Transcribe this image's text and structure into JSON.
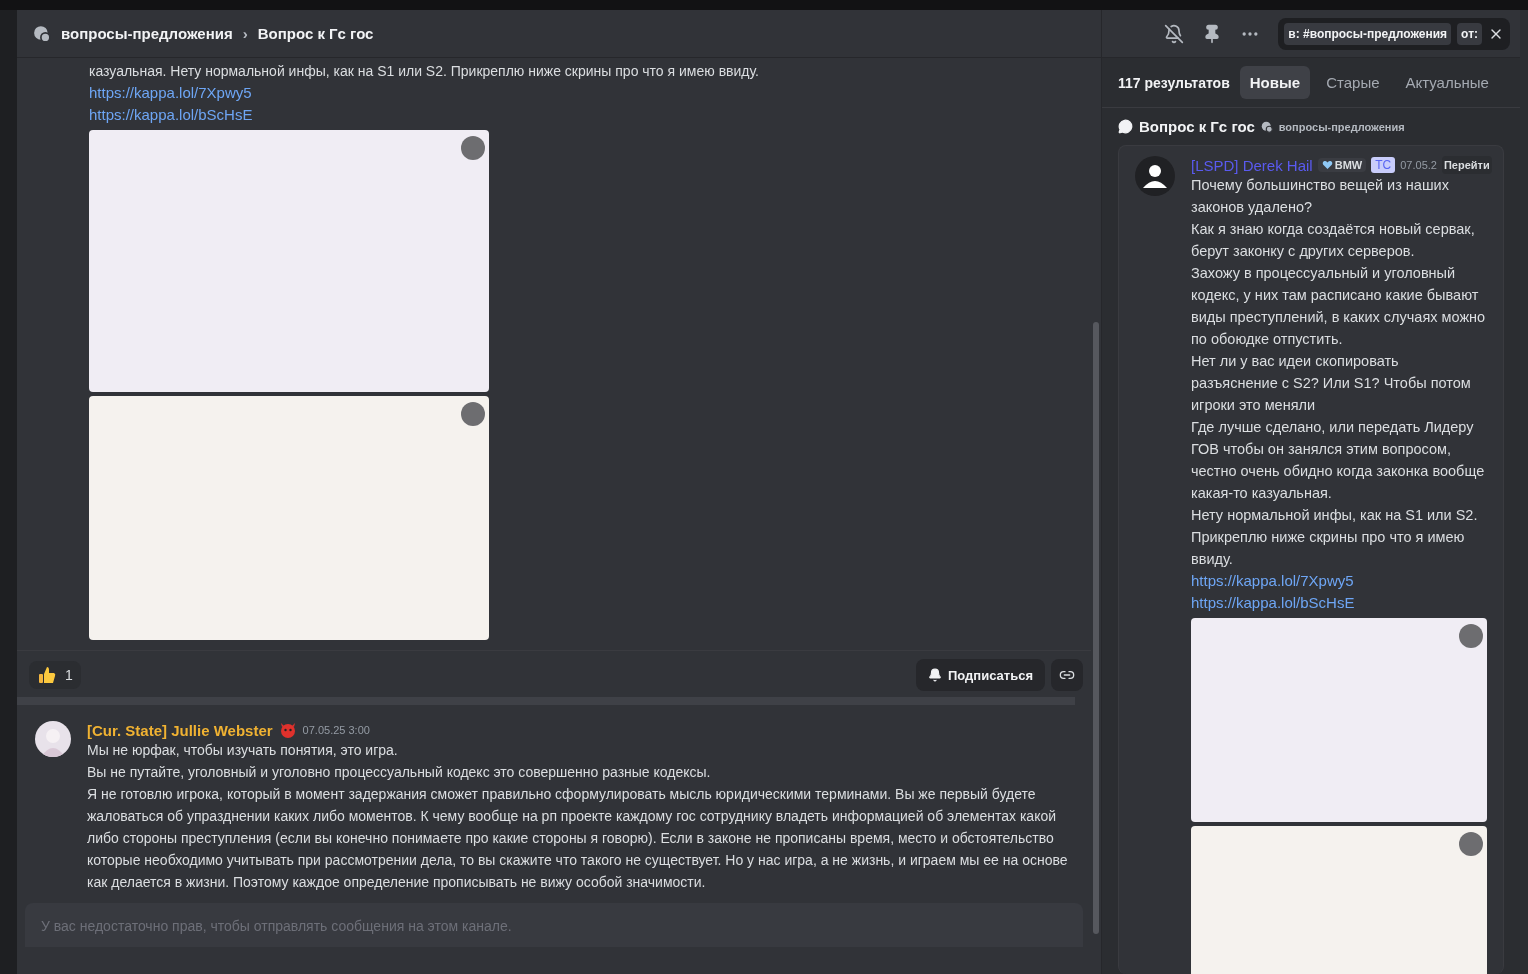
{
  "header": {
    "channel": "вопросы-предложения",
    "separator": "›",
    "thread": "Вопрос к Гс гос"
  },
  "search": {
    "chips": [
      "в: #вопросы-предложения",
      "от:"
    ]
  },
  "main_message": {
    "text_tail": "казуальная. Нету нормальной инфы, как на S1 или S2. Прикреплю ниже скрины про что я имею ввиду.",
    "links": [
      "https://kappa.lol/7Xpwy5",
      "https://kappa.lol/bScHsE"
    ],
    "attachments": [
      {
        "kind": "image"
      },
      {
        "kind": "image"
      }
    ]
  },
  "reactions": [
    {
      "count": "1"
    }
  ],
  "thread_actions": {
    "follow": "Подписаться"
  },
  "reply": {
    "author": "[Cur. State] Jullie Webster",
    "time": "07.05.25 3:00",
    "paragraphs": [
      "Мы не юрфак, чтобы изучать понятия, это игра.",
      "Вы не путайте, уголовный и уголовно процессуальный кодекс это совершенно разные кодексы.",
      "Я не готовлю игрока, который в момент задержания сможет правильно сформулировать мысль юридическими терминами. Вы же первый будете жаловаться об упразднении каких либо моментов. К чему вообще на рп проекте каждому гос сотруднику владеть информацией об элементах какой либо стороны преступления (если вы конечно понимаете про какие стороны я говорю). Если в законе не прописаны время, место и обстоятельство которые необходимо учитывать при рассмотрении дела, то вы скажите что такого не существует. Но у нас игра, а не жизнь, и играем мы ее на основе как делается в жизни. Поэтому каждое определение прописывать не вижу особой значимости."
    ]
  },
  "composer": {
    "placeholder": "У вас недостаточно прав, чтобы отправлять сообщения на этом канале."
  },
  "results": {
    "count": "117 результатов",
    "tabs": [
      {
        "label": "Новые",
        "selected": true
      },
      {
        "label": "Старые",
        "selected": false
      },
      {
        "label": "Актуальные",
        "selected": false
      }
    ],
    "thread": {
      "title": "Вопрос к Гс гос",
      "channel": "вопросы-предложения"
    },
    "result": {
      "author": "[LSPD] Derek Hail",
      "tag": "BMW",
      "badge": "ТС",
      "time": "07.05.2",
      "jump": "Перейти",
      "paragraphs": [
        "Почему большинство вещей из наших законов удалено?",
        "Как я знаю когда создаётся новый сервак, берут законку с других серверов.",
        "Захожу в процессуальный и уголовный кодекс, у них там расписано какие бывают виды преступлений, в каких случаях можно по обоюдке отпустить.",
        "Нет ли у вас идеи скопировать разъяснение с S2? Или S1? Чтобы потом игроки это меняли",
        "Где лучше сделано, или передать Лидеру ГОВ чтобы он занялся этим вопросом, честно очень обидно когда законка вообще какая-то казуальная.",
        "Нету нормальной инфы, как на S1 или S2. Прикреплю ниже скрины про что я имею ввиду."
      ],
      "links": [
        "https://kappa.lol/7Xpwy5",
        "https://kappa.lol/bScHsE"
      ],
      "attachments": [
        {
          "kind": "image"
        },
        {
          "kind": "image"
        }
      ]
    }
  }
}
